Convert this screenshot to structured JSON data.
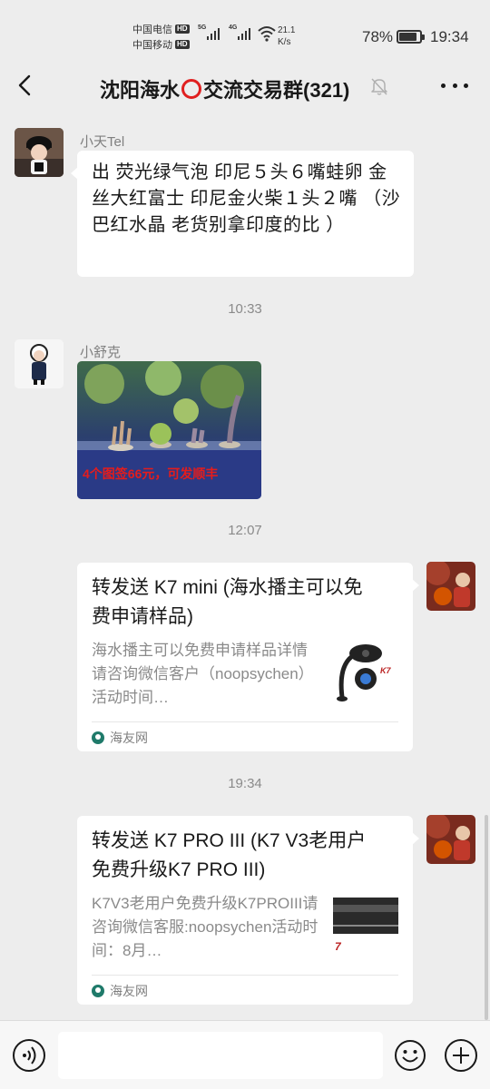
{
  "status_bar": {
    "carrier1": "中国电信",
    "carrier2": "中国移动",
    "hd": "HD",
    "net1": "5G",
    "net2": "4G",
    "speed_value": "21.1",
    "speed_unit": "K/s",
    "battery": "78%",
    "battery_level": 0.78,
    "time": "19:34"
  },
  "header": {
    "title_part1": "沈阳海水",
    "title_part2": "交流交易群(321)",
    "icons": [
      "back-icon",
      "mute-icon",
      "more-icon"
    ]
  },
  "messages": [
    {
      "sender": "小天Tel",
      "text": "出  荧光绿气泡  印尼５头６嘴蛙卵   金丝大红富士   印尼金火柴１头２嘴   （沙巴红水晶 老货别拿印度的比   ）"
    },
    {
      "time": "10:33"
    },
    {
      "sender": "小舒克",
      "image_caption": "4个图签66元，可发顺丰"
    },
    {
      "time": "12:07"
    },
    {
      "card_title": "转发送 K7 mini (海水播主可以免费申请样品)",
      "card_desc": "海水播主可以免费申请样品详情请咨询微信客户（noopsychen）活动时间…",
      "card_source": "海友网"
    },
    {
      "time": "19:34"
    },
    {
      "card_title": "转发送 K7 PRO III (K7 V3老用户免费升级K7 PRO III)",
      "card_desc": "K7V3老用户免费升级K7PROIII请咨询微信客服:noopsychen活动时间：8月…",
      "card_source": "海友网"
    }
  ],
  "input_bar": {
    "placeholder": "",
    "icons": [
      "voice-icon",
      "emoji-icon",
      "plus-icon"
    ]
  },
  "colors": {
    "background": "#ededed",
    "bubble": "#ffffff",
    "accent_red": "#e02020",
    "source_icon": "#1f7a6a"
  }
}
